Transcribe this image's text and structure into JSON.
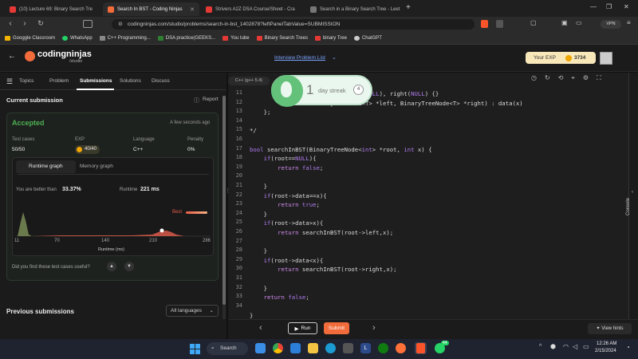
{
  "browser": {
    "tabs": [
      {
        "title": "(10) Lecture 69: Binary Search Tre",
        "color": "#e53935"
      },
      {
        "title": "Search In BST - Coding Ninjas",
        "color": "#f26b3a"
      },
      {
        "title": "Strivers A2Z DSA Course/Sheet - Cra",
        "color": "#e53935"
      },
      {
        "title": "Search in a Binary Search Tree - Leet",
        "color": "#777777"
      }
    ],
    "new_tab": "+",
    "url": "codingninjas.com/studio/problems/search-in-bst_1402878?leftPanelTabValue=SUBMISSION",
    "vpn": "VPN",
    "bookmarks": [
      {
        "label": "Googgle Classroom",
        "color": "#f4b400"
      },
      {
        "label": "WhatsApp",
        "color": "#25d366"
      },
      {
        "label": "C++ Programming...",
        "color": "#888888"
      },
      {
        "label": "DSA practice(GEEKS...",
        "color": "#2e7d32"
      },
      {
        "label": "You tube",
        "color": "#e53935"
      },
      {
        "label": "Binary Search Trees",
        "color": "#e53935"
      },
      {
        "label": "binary Tree",
        "color": "#e53935"
      },
      {
        "label": "ChatGPT",
        "color": "#cccccc"
      }
    ]
  },
  "site": {
    "logo_text": "codingninjas",
    "logo_sub": "/studio",
    "interview_link": "Interview Problem List",
    "exp_label": "Your EXP",
    "exp_value": "3734"
  },
  "panel_tabs": {
    "topics": "Topics",
    "problem": "Problem",
    "submissions": "Submissions",
    "solutions": "Solutions",
    "discuss": "Discuss"
  },
  "submission": {
    "heading": "Current submission",
    "report": "Report",
    "status": "Accepted",
    "time_ago": "A few seconds ago",
    "test_cases_label": "Test cases",
    "test_cases_value": "50/50",
    "exp_label": "EXP",
    "exp_value": "40/40",
    "language_label": "Language",
    "language_value": "C++",
    "penalty_label": "Penalty",
    "penalty_value": "0%",
    "runtime_tab": "Runtime graph",
    "memory_tab": "Memory graph",
    "better_than_text": "You are better than",
    "better_than_value": "33.37%",
    "runtime_label": "Runtime",
    "runtime_value": "221 ms",
    "best_label": "Best",
    "x_ticks": [
      "11",
      "70",
      "140",
      "210",
      "286"
    ],
    "x_axis_label": "Runtime (ms)",
    "feedback_question": "Did you find these test cases useful?",
    "previous_heading": "Previous submissions",
    "languages_select": "All languages"
  },
  "editor": {
    "language": "C++ (g++ 5.4)",
    "streak_value": "1",
    "streak_label": "day streak",
    "streak_badge": "4",
    "line_numbers": [
      "11",
      "12",
      "13",
      "14",
      "15",
      "16",
      "17",
      "18",
      "19",
      "20",
      "21",
      "22",
      "23",
      "24",
      "25",
      "26",
      "27",
      "28",
      "29",
      "30",
      "31",
      "32",
      "33",
      "34"
    ],
    "code_lines": [
      "                   data(x), left(NULL), right(NULL) {}",
      "                   inaryTreeNode<T> *left, BinaryTreeNode<T> *right) : data(x)",
      "    };",
      "",
      "*/",
      "",
      "bool searchInBST(BinaryTreeNode<int> *root, int x) {",
      "    if(root==NULL){",
      "        return false;",
      "",
      "    }",
      "    if(root->data==x){",
      "        return true;",
      "    }",
      "    if(root->data>x){",
      "        return searchInBST(root->left,x);",
      "",
      "    }",
      "    if(root->data<x){",
      "        return searchInBST(root->right,x);",
      "",
      "    }",
      "    return false;",
      "",
      "}"
    ],
    "console_label": "Console",
    "run_label": "Run",
    "submit_label": "Submit",
    "hints_label": "View hints"
  },
  "taskbar": {
    "search_label": "Search",
    "badge_count": "44",
    "time": "12:26 AM",
    "date": "2/15/2024"
  }
}
